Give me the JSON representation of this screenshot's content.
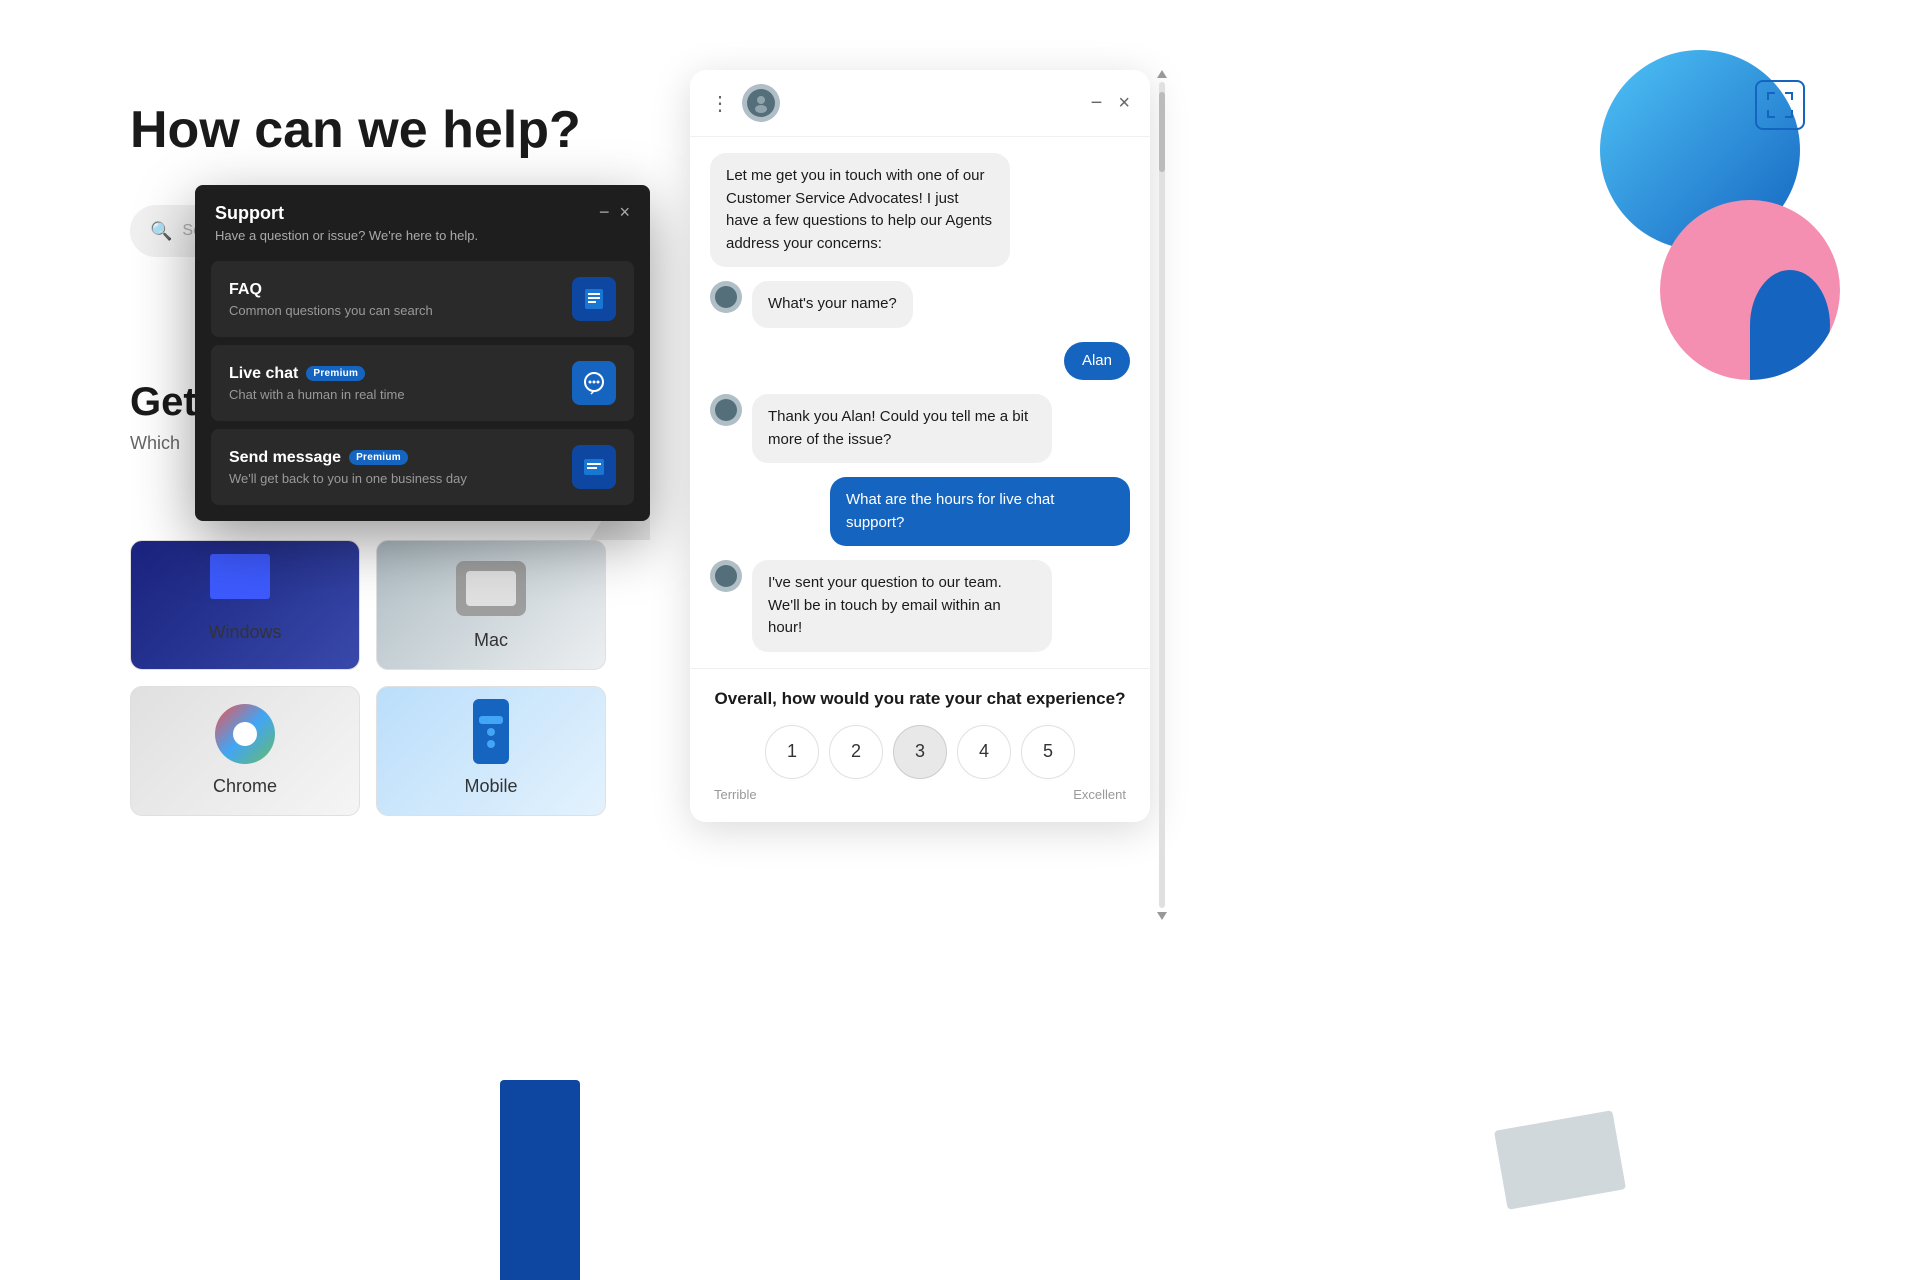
{
  "page": {
    "title": "How can we help?",
    "search_placeholder": "Sea..."
  },
  "get_section": {
    "title": "Gett",
    "subtitle": "Which"
  },
  "platforms": [
    {
      "id": "windows",
      "label": "Windows"
    },
    {
      "id": "mac",
      "label": "Mac"
    },
    {
      "id": "chrome",
      "label": "Chrome"
    },
    {
      "id": "mobile",
      "label": "Mobile"
    }
  ],
  "support_panel": {
    "title": "Support",
    "subtitle": "Have a question or issue? We're here to help.",
    "items": [
      {
        "id": "faq",
        "title": "FAQ",
        "description": "Common questions you can search",
        "badge": null,
        "icon": "📋"
      },
      {
        "id": "live-chat",
        "title": "Live chat",
        "description": "Chat with a human in real time",
        "badge": "Premium",
        "icon": "💬"
      },
      {
        "id": "send-message",
        "title": "Send message",
        "description": "We'll get back to you in one business day",
        "badge": "Premium",
        "icon": "📩"
      }
    ]
  },
  "chat": {
    "minimize_label": "−",
    "close_label": "×",
    "messages": [
      {
        "id": 1,
        "type": "agent",
        "text": "Let me get you in touch with one of our Customer Service Advocates! I just have a few questions to help our Agents address your concerns:"
      },
      {
        "id": 2,
        "type": "agent",
        "text": "What's your name?"
      },
      {
        "id": 3,
        "type": "user",
        "text": "Alan"
      },
      {
        "id": 4,
        "type": "agent",
        "text": "Thank you Alan! Could you tell me a bit more of the issue?"
      },
      {
        "id": 5,
        "type": "user",
        "text": "What are the hours for live chat support?"
      },
      {
        "id": 6,
        "type": "agent",
        "text": "I've sent your question to our team. We'll be in touch by email within an hour!"
      }
    ],
    "rating": {
      "title": "Overall, how would you rate your chat experience?",
      "options": [
        1,
        2,
        3,
        4,
        5
      ],
      "selected": 3,
      "label_low": "Terrible",
      "label_high": "Excellent"
    }
  },
  "nav": {
    "icons": [
      "☰",
      "⌂",
      "↺",
      "👤",
      "ℹ",
      "?",
      "◉"
    ]
  }
}
